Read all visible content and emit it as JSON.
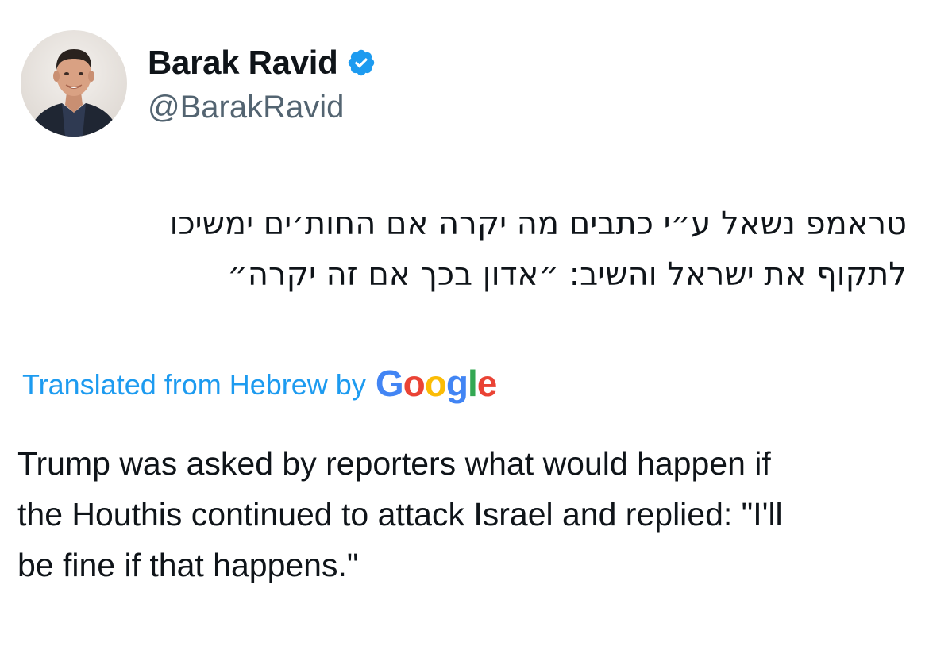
{
  "author": {
    "display_name": "Barak Ravid",
    "handle": "@BarakRavid",
    "verified": true,
    "verified_icon": "verified-badge-icon",
    "verified_color": "#1d9bf0"
  },
  "tweet": {
    "original_lines": [
      "טראמפ נשאל ע״י כתבים מה יקרה אם החות׳ים ימשיכו",
      "לתקוף את ישראל והשיב: ״אדון בכך אם זה יקרה״"
    ],
    "translated_from": "Translated from Hebrew by",
    "translator_logo": {
      "letters": [
        "G",
        "o",
        "o",
        "g",
        "l",
        "e"
      ],
      "colors": [
        "#4285f4",
        "#ea4335",
        "#fbbc05",
        "#4285f4",
        "#34a853",
        "#ea4335"
      ]
    },
    "translation": "Trump was asked by reporters what would happen if\nthe Houthis continued to attack Israel and replied: \"I'll\nbe fine if that happens.\""
  },
  "colors": {
    "text": "#0f1419",
    "secondary": "#536471",
    "link": "#1d9bf0"
  }
}
